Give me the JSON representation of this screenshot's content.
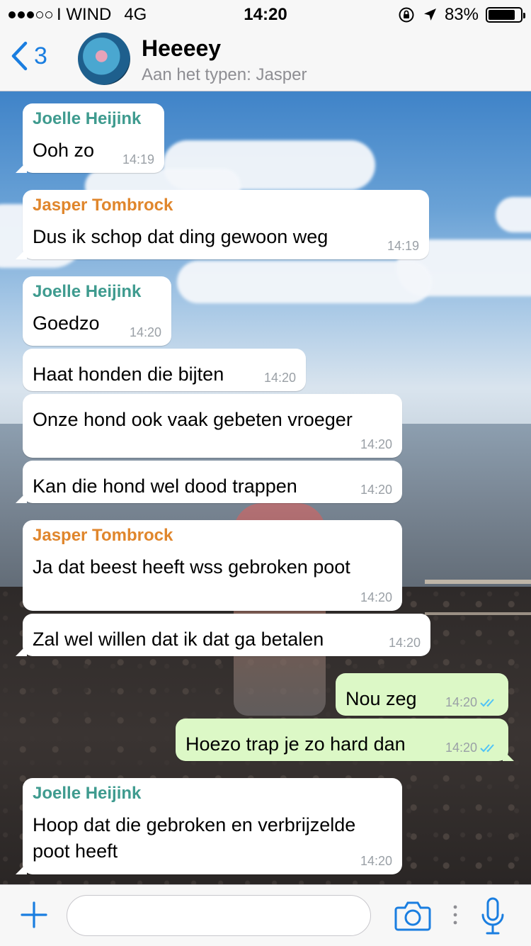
{
  "status_bar": {
    "signal_dots_filled": 3,
    "signal_dots_total": 5,
    "carrier": "I WIND",
    "network": "4G",
    "time": "14:20",
    "battery": "83%",
    "battery_level_percent": 83
  },
  "header": {
    "back_count": "3",
    "title": "Heeeey",
    "subtitle": "Aan het typen: Jasper"
  },
  "colors": {
    "accent": "#1a7ee0",
    "sender_joelle": "#3f9b8f",
    "sender_jasper": "#e0862c",
    "outgoing_bubble": "#dcf8c6",
    "incoming_bubble": "#ffffff",
    "read_ticks": "#4fc3f7"
  },
  "messages": [
    {
      "direction": "in",
      "sender": "Joelle Heijink",
      "sender_color": "#3f9b8f",
      "lines": [
        "Ooh zo"
      ],
      "time": "14:19"
    },
    {
      "direction": "in",
      "sender": "Jasper Tombrock",
      "sender_color": "#e0862c",
      "lines": [
        "Dus ik schop dat ding gewoon weg"
      ],
      "time": "14:19"
    },
    {
      "direction": "in",
      "sender": "Joelle Heijink",
      "sender_color": "#3f9b8f",
      "lines": [
        "Goedzo"
      ],
      "time": "14:20"
    },
    {
      "direction": "in",
      "sender": "",
      "lines": [
        "Haat honden die bijten"
      ],
      "time": "14:20"
    },
    {
      "direction": "in",
      "sender": "",
      "lines": [
        "Onze hond ook vaak gebeten vroeger"
      ],
      "time": "14:20"
    },
    {
      "direction": "in",
      "sender": "",
      "lines": [
        "Kan die hond wel dood trappen"
      ],
      "time": "14:20"
    },
    {
      "direction": "in",
      "sender": "Jasper Tombrock",
      "sender_color": "#e0862c",
      "lines": [
        "Ja dat beest heeft wss gebroken poot"
      ],
      "time": "14:20"
    },
    {
      "direction": "in",
      "sender": "",
      "lines": [
        "Zal wel willen dat ik dat ga betalen"
      ],
      "time": "14:20"
    },
    {
      "direction": "out",
      "sender": "",
      "lines": [
        "Nou zeg"
      ],
      "time": "14:20",
      "read": true
    },
    {
      "direction": "out",
      "sender": "",
      "lines": [
        "Hoezo trap je zo hard dan"
      ],
      "time": "14:20",
      "read": true
    },
    {
      "direction": "in",
      "sender": "Joelle Heijink",
      "sender_color": "#3f9b8f",
      "lines": [
        "Hoop dat die gebroken en verbrijzelde",
        "poot heeft"
      ],
      "time": "14:20"
    }
  ],
  "input": {
    "placeholder": ""
  },
  "icons": {
    "back": "chevron-left-icon",
    "attach": "plus-icon",
    "camera": "camera-icon",
    "more": "vertical-dots-icon",
    "mic": "microphone-icon"
  }
}
